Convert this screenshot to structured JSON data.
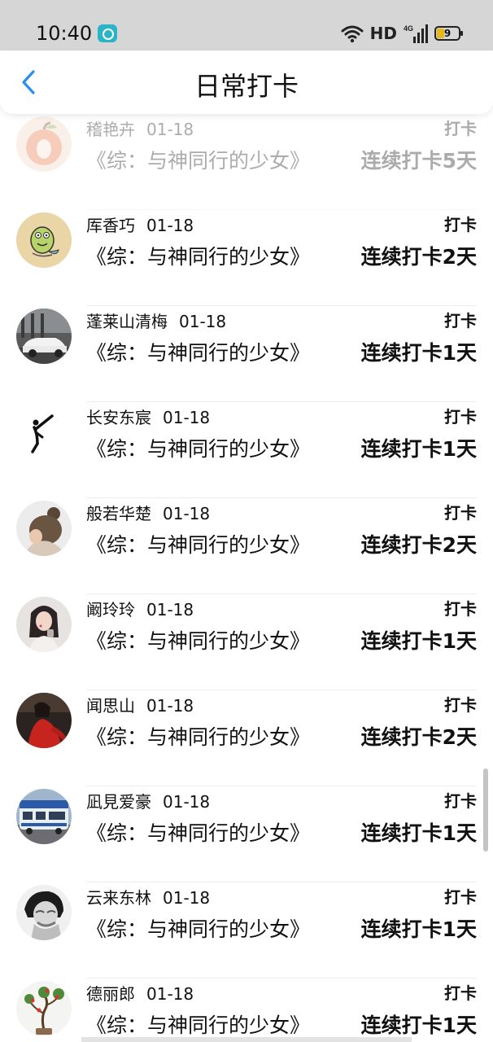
{
  "status_bar": {
    "time": "10:40",
    "network": "HD",
    "signal_label": "4G",
    "battery": "9",
    "battery_color": "#e7b81a"
  },
  "header": {
    "title": "日常打卡",
    "accent_color": "#2a8ef0"
  },
  "checkins": [
    {
      "name": "稽艳卉",
      "date": "01-18",
      "tag": "打卡",
      "book": "《综：与神同行的少女》",
      "streak": "连续打卡5天",
      "avatar": "apple-drawing"
    },
    {
      "name": "厍香巧",
      "date": "01-18",
      "tag": "打卡",
      "book": "《综：与神同行的少女》",
      "streak": "连续打卡2天",
      "avatar": "cartoon-fish"
    },
    {
      "name": "蓬莱山清梅",
      "date": "01-18",
      "tag": "打卡",
      "book": "《综：与神同行的少女》",
      "streak": "连续打卡1天",
      "avatar": "car-building"
    },
    {
      "name": "长安东宸",
      "date": "01-18",
      "tag": "打卡",
      "book": "《综：与神同行的少女》",
      "streak": "连续打卡1天",
      "avatar": "kick-figure"
    },
    {
      "name": "般若华楚",
      "date": "01-18",
      "tag": "打卡",
      "book": "《综：与神同行的少女》",
      "streak": "连续打卡2天",
      "avatar": "girl-hair-bun"
    },
    {
      "name": "阚玲玲",
      "date": "01-18",
      "tag": "打卡",
      "book": "《综：与神同行的少女》",
      "streak": "连续打卡1天",
      "avatar": "girl-portrait"
    },
    {
      "name": "闻思山",
      "date": "01-18",
      "tag": "打卡",
      "book": "《综：与神同行的少女》",
      "streak": "连续打卡2天",
      "avatar": "red-dress-girl"
    },
    {
      "name": "凪見爱豪",
      "date": "01-18",
      "tag": "打卡",
      "book": "《综：与神同行的少女》",
      "streak": "连续打卡1天",
      "avatar": "bus-street"
    },
    {
      "name": "云来东林",
      "date": "01-18",
      "tag": "打卡",
      "book": "《综：与神同行的少女》",
      "streak": "连续打卡1天",
      "avatar": "crying-person"
    },
    {
      "name": "德丽郎",
      "date": "01-18",
      "tag": "打卡",
      "book": "《综：与神同行的少女》",
      "streak": "连续打卡1天",
      "avatar": "bonsai-tree"
    }
  ]
}
